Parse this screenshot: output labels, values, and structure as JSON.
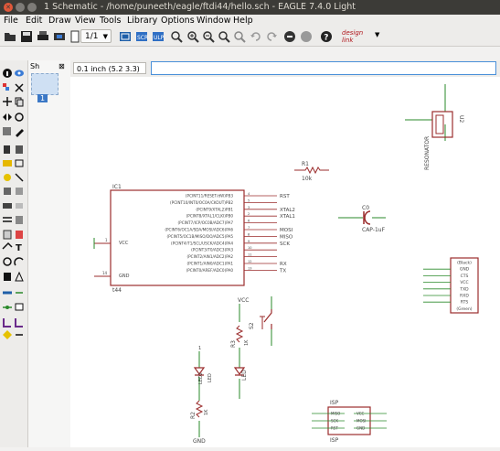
{
  "window": {
    "title": "1 Schematic - /home/puneeth/eagle/ftdi44/hello.sch - EAGLE 7.4.0 Light"
  },
  "menu": {
    "file": "File",
    "edit": "Edit",
    "draw": "Draw",
    "view": "View",
    "tools": "Tools",
    "library": "Library",
    "options": "Options",
    "window": "Window",
    "help": "Help"
  },
  "toolbar": {
    "sheet_select": "1/1",
    "logo_text": "design link"
  },
  "sheets_panel": {
    "tab_label": "Sh",
    "sheet_number": "1"
  },
  "command_bar": {
    "coordinate": "0.1 inch (5.2 3.3)",
    "command_value": ""
  },
  "schematic": {
    "ic1": {
      "name": "IC1",
      "value": "t44",
      "vcc": "VCC",
      "gnd": "GND",
      "pin_vcc": "1",
      "pin_gnd": "14",
      "pins_right": [
        {
          "label": "(PCINT11/RESET/dW)PB3",
          "num": "4",
          "net": "RST"
        },
        {
          "label": "(PCINT10/INT0/OC0A/CKOUT)PB2",
          "num": "5",
          "net": ""
        },
        {
          "label": "(PCINT9/XTAL2)PB1",
          "num": "3",
          "net": "XTAL2"
        },
        {
          "label": "(PCINT8/XTAL1/CLKI)PB0",
          "num": "2",
          "net": "XTAL1"
        },
        {
          "label": "(PCINT7/ICP/OC0B/ADC7)PA7",
          "num": "6",
          "net": ""
        },
        {
          "label": "(PCINT6/OC1A/SDA/MOSI/ADC6)PA6",
          "num": "7",
          "net": "MOSI"
        },
        {
          "label": "(PCINT5/OC1B/MISO/DO/ADC5)PA5",
          "num": "8",
          "net": "MISO"
        },
        {
          "label": "(PCINT4/T1/SCL/USCK/ADC4)PA4",
          "num": "9",
          "net": "SCK"
        },
        {
          "label": "(PCINT3/T0/ADC3)PA3",
          "num": "10",
          "net": ""
        },
        {
          "label": "(PCINT2/AIN1/ADC2)PA2",
          "num": "11",
          "net": ""
        },
        {
          "label": "(PCINT1/AIN0/ADC1)PA1",
          "num": "12",
          "net": "RX"
        },
        {
          "label": "(PCINT0/AREF/ADC0)PA0",
          "num": "13",
          "net": "TX"
        }
      ]
    },
    "r1": {
      "name": "R1",
      "value": "10k"
    },
    "c0": {
      "name": "C0",
      "value": "CAP-1uF"
    },
    "u2": {
      "name": "U2",
      "value": "RESONATOR"
    },
    "ftdi": {
      "pins": [
        "(Black)",
        "GND",
        "CTS",
        "VCC",
        "TXD",
        "RXD",
        "RTS",
        "(Green)"
      ]
    },
    "s2": {
      "name": "S2",
      "vcc": "VCC"
    },
    "r3": {
      "name": "R3",
      "value": "1K"
    },
    "led1": {
      "name": "LED1",
      "value": "LED"
    },
    "r2": {
      "name": "R2",
      "value": "1K"
    },
    "led2": {
      "name": "LED2",
      "value": "LED"
    },
    "isp": {
      "name": "ISP",
      "value": "ISP",
      "pins_left": [
        "MISO",
        "SCK",
        "RST"
      ],
      "pins_right": [
        "VCC",
        "MOSI",
        "GND"
      ]
    },
    "gnd_label": "GND",
    "gnd_pin": "1"
  }
}
